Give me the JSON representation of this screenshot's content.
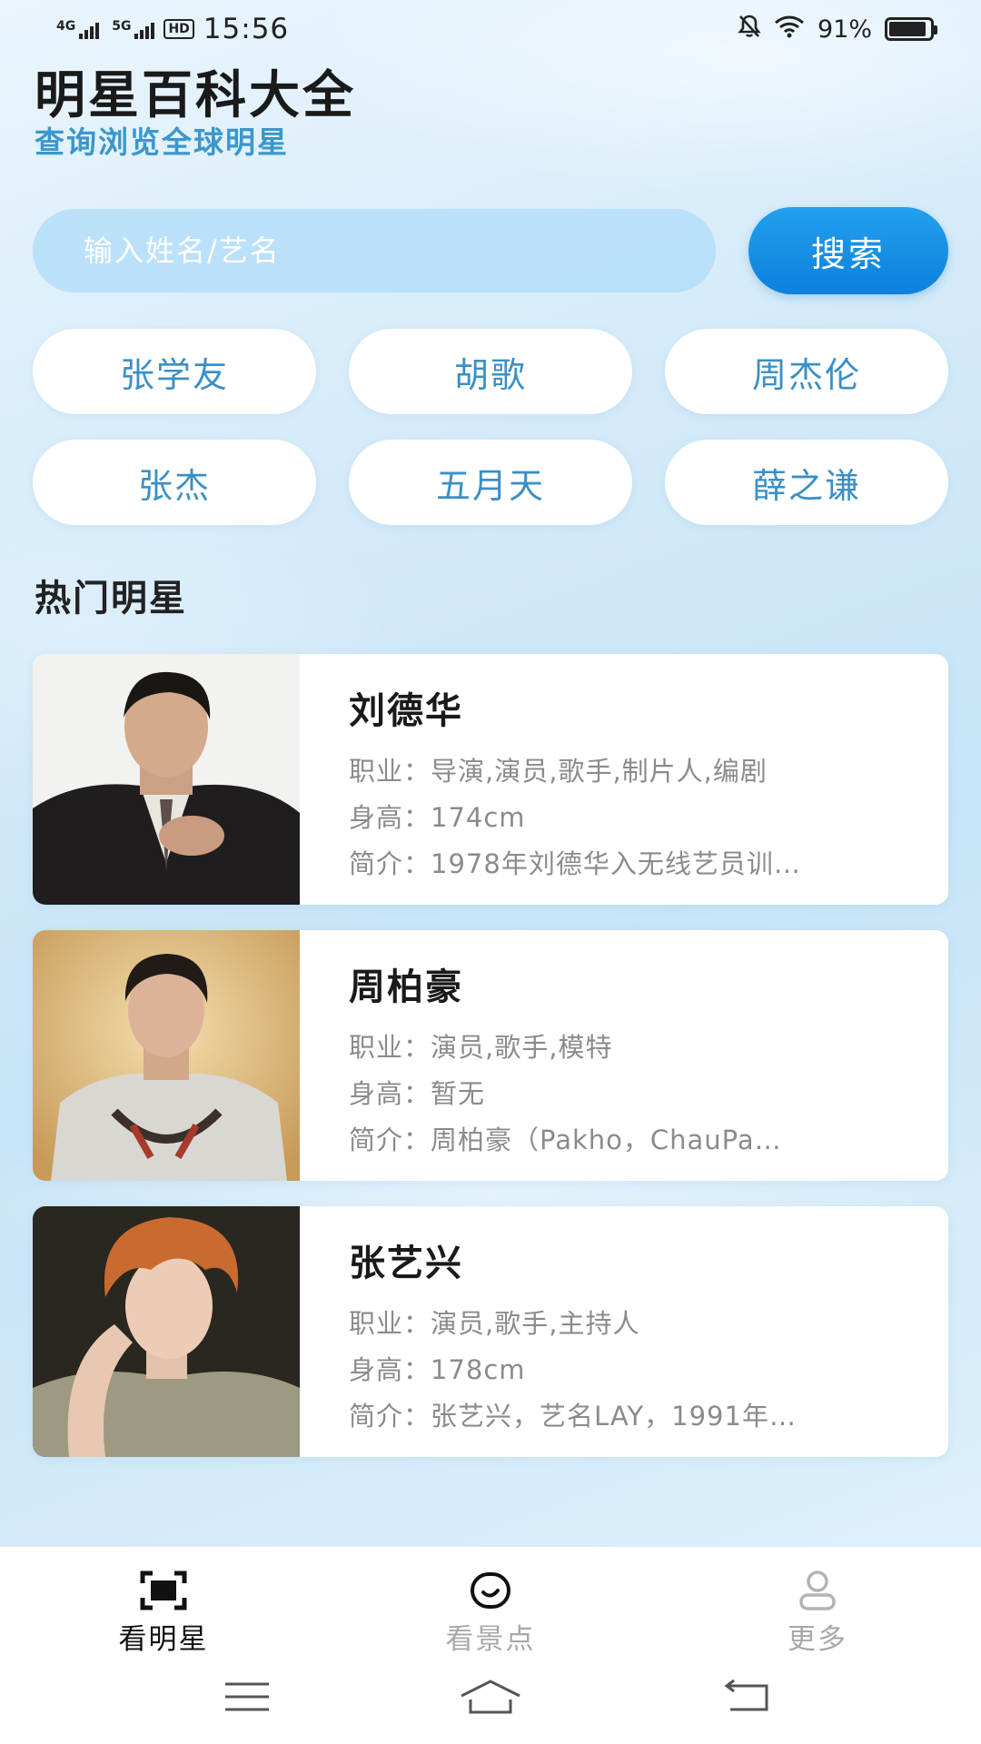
{
  "status_bar": {
    "net1": "4G",
    "net2": "5G",
    "hd": "HD",
    "time": "15:56",
    "battery": "91%",
    "battery_level": 0.91,
    "icons": [
      "mute-bell-icon",
      "wifi-icon",
      "battery-icon"
    ]
  },
  "header": {
    "title": "明星百科大全",
    "subtitle": "查询浏览全球明星"
  },
  "search": {
    "placeholder": "输入姓名/艺名",
    "button_label": "搜索"
  },
  "hot_tags": [
    "张学友",
    "胡歌",
    "周杰伦",
    "张杰",
    "五月天",
    "薛之谦"
  ],
  "section_title": "热门明星",
  "stars": [
    {
      "name": "刘德华",
      "job_label": "职业：",
      "job": "导演,演员,歌手,制片人,编剧",
      "height_label": "身高：",
      "height": "174cm",
      "intro_label": "简介：",
      "intro": "1978年刘德华入无线艺员训…"
    },
    {
      "name": "周柏豪",
      "job_label": "职业：",
      "job": "演员,歌手,模特",
      "height_label": "身高：",
      "height": "暂无",
      "intro_label": "简介：",
      "intro": "周柏豪（Pakho，ChauPa…"
    },
    {
      "name": "张艺兴",
      "job_label": "职业：",
      "job": "演员,歌手,主持人",
      "height_label": "身高：",
      "height": "178cm",
      "intro_label": "简介：",
      "intro": "张艺兴，艺名LAY，1991年…"
    }
  ],
  "bottom_nav": [
    {
      "label": "看明星",
      "icon": "scan-frame-icon",
      "active": true
    },
    {
      "label": "看景点",
      "icon": "smile-icon",
      "active": false
    },
    {
      "label": "更多",
      "icon": "user-icon",
      "active": false
    }
  ],
  "system_nav": [
    "menu-icon",
    "home-icon",
    "back-icon"
  ],
  "colors": {
    "accent": "#0d80dc",
    "subtitle": "#3b97cd",
    "tag_text": "#3c8fc4",
    "secondary_text": "#8b8b8b"
  }
}
